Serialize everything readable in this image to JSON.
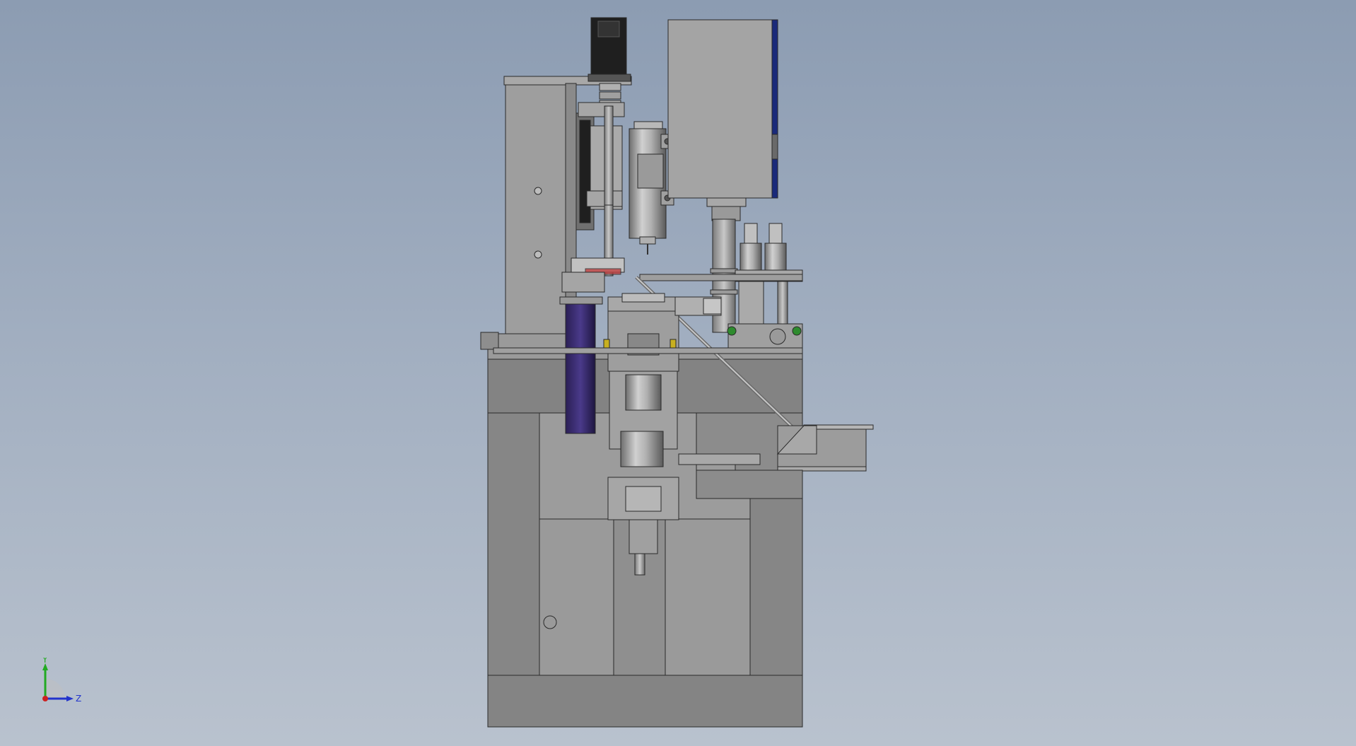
{
  "window": {
    "background_top": "#8c9cb2",
    "background_bottom": "#b9c2ce"
  },
  "model": {
    "description_name": "cad-assembly-front-view",
    "body_color": "#8a8a8a",
    "frame_color": "#7d7d7d",
    "panel_color": "#999999",
    "edge_color": "#2a2a2a",
    "motor_color": "#1f1f1f",
    "belt_color": "#3a2a6a",
    "accent_green": "#2e8b2e",
    "accent_yellow": "#c8b020",
    "accent_red": "#c04040",
    "accent_blue": "#1a2a7a"
  },
  "triad": {
    "y_label": "Y",
    "z_label": "Z",
    "y_color": "#22aa22",
    "z_color": "#2233cc",
    "origin_color": "#cc2222"
  }
}
